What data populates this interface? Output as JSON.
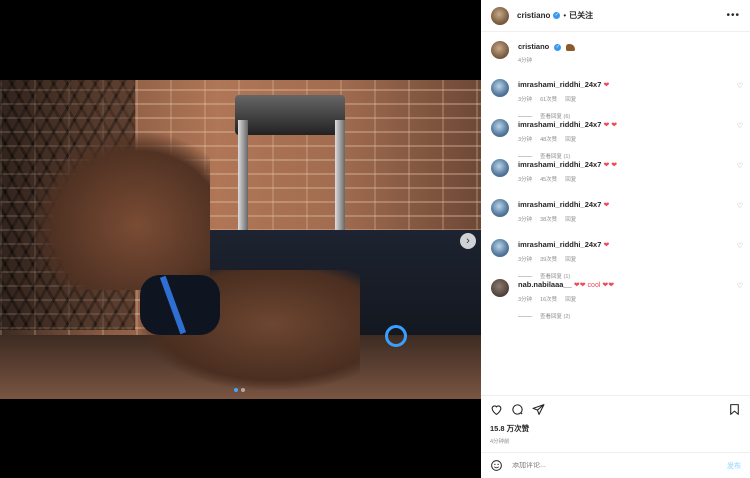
{
  "header": {
    "username": "cristiano",
    "dot": "•",
    "follow_label": "已关注",
    "more": "•••"
  },
  "caption": {
    "username": "cristiano",
    "time": "4分钟"
  },
  "comments": [
    {
      "username": "imrashami_riddhi_24x7",
      "text": "❤",
      "time": "3分钟",
      "likes": "61次赞",
      "reply": "回复",
      "view_replies": "查看回复 (6)"
    },
    {
      "username": "imrashami_riddhi_24x7",
      "text": "❤ ❤",
      "time": "3分钟",
      "likes": "48次赞",
      "reply": "回复",
      "view_replies": "查看回复 (1)"
    },
    {
      "username": "imrashami_riddhi_24x7",
      "text": "❤ ❤",
      "time": "3分钟",
      "likes": "45次赞",
      "reply": "回复",
      "view_replies": ""
    },
    {
      "username": "imrashami_riddhi_24x7",
      "text": "❤",
      "time": "3分钟",
      "likes": "38次赞",
      "reply": "回复",
      "view_replies": ""
    },
    {
      "username": "imrashami_riddhi_24x7",
      "text": "❤",
      "time": "3分钟",
      "likes": "39次赞",
      "reply": "回复",
      "view_replies": "查看回复 (1)"
    },
    {
      "username": "nab.nabilaaa__",
      "text": "❤❤ cool ❤❤",
      "time": "3分钟",
      "likes": "16次赞",
      "reply": "回复",
      "view_replies": "查看回复 (2)"
    }
  ],
  "actions": {
    "likes": "15.8 万次赞",
    "time": "4分钟前"
  },
  "add_comment": {
    "placeholder": "添加评论...",
    "post_label": "发布"
  },
  "carousel": {
    "next": "›",
    "dots": 2,
    "active_dot": 1
  },
  "colors": {
    "verified": "#3897f0",
    "heart": "#ed4956",
    "post_disabled": "#b2dffc",
    "extension_accent": "#8a5cf6"
  }
}
